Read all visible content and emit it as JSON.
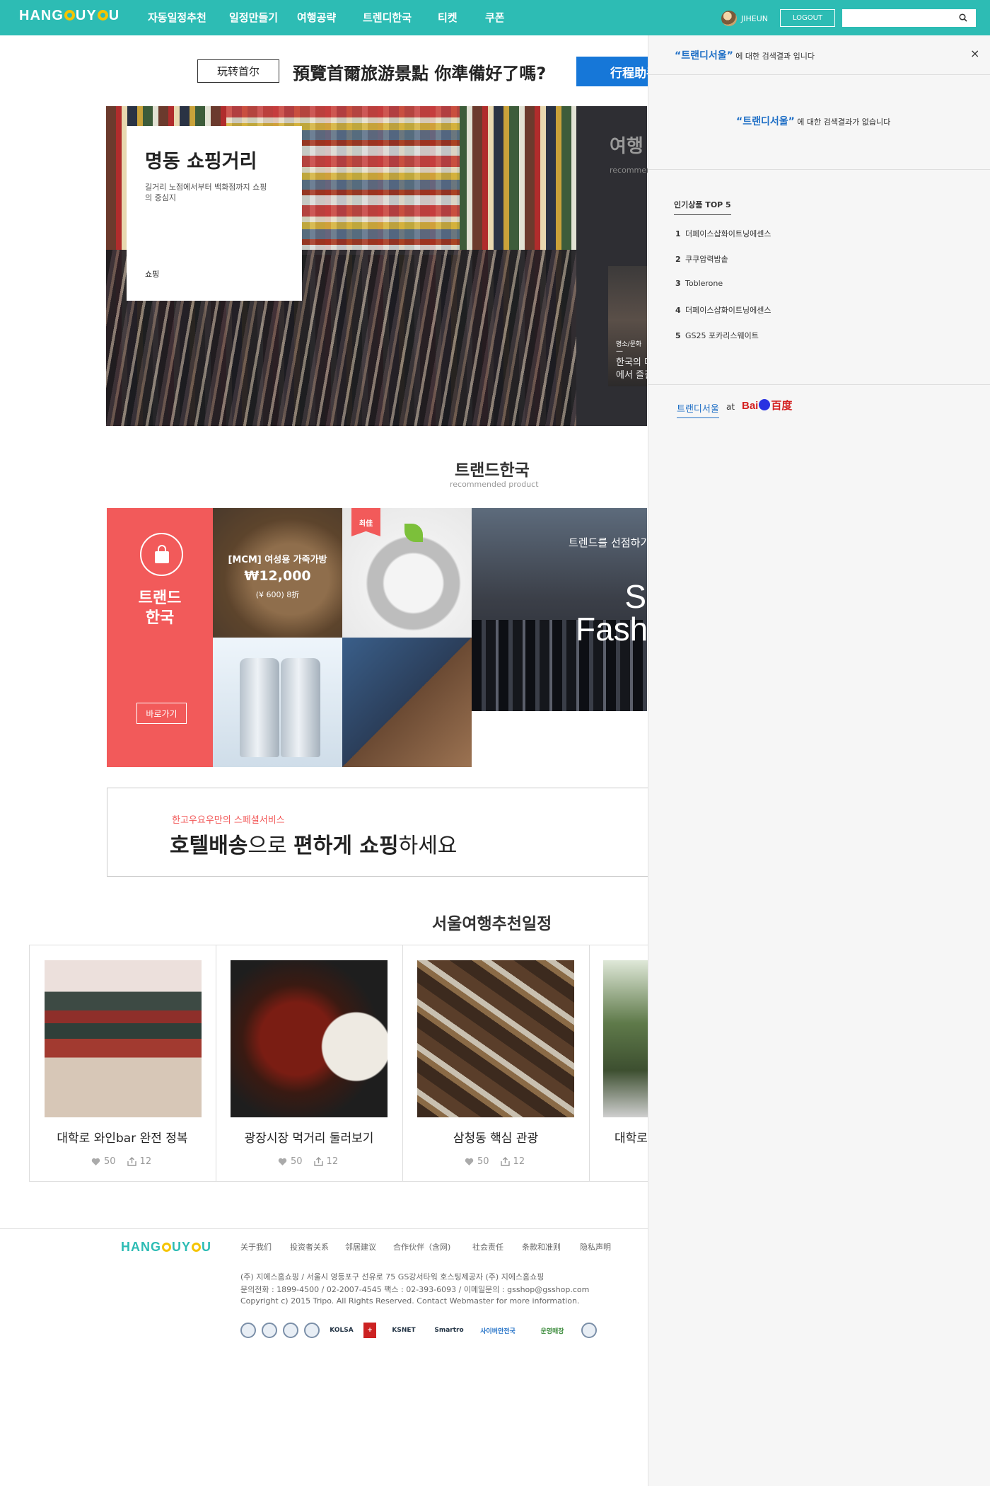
{
  "header": {
    "logo": {
      "pre": "HANG",
      "post": "UY",
      "last": "U"
    },
    "nav": [
      "자동일정추천",
      "일정만들기",
      "여행공략",
      "트렌디한국",
      "티켓",
      "쿠폰"
    ],
    "user": "JIHEUN",
    "logout": "LOGOUT",
    "search_value": "",
    "colors": {
      "bar": "#2dbcb4",
      "logo_o": "#f5c400"
    }
  },
  "promo": {
    "tag": "玩转首尔",
    "text": "預覽首爾旅游景點 你準備好了嗎?",
    "button": "行程助手"
  },
  "hero": {
    "title": "명동 쇼핑거리",
    "desc": "길거리 노점에서부터 백화점까지 쇼핑의 중심지",
    "category": "쇼핑",
    "side_title": "여행",
    "side_sub": "recommen",
    "side_card_cat": "명소/문화",
    "side_card_dash": "—",
    "side_card_text1": "한국의 다",
    "side_card_text2": "에서 즐길"
  },
  "trend": {
    "title": "트랜드한국",
    "subtitle": "recommended product",
    "panel_title_1": "트랜드",
    "panel_title_2": "한국",
    "goto": "바로가기",
    "bag_name": "[MCM] 여성용 가죽가방",
    "bag_price": "₩12,000",
    "bag_cny": "(¥ 600) 8折",
    "best_badge": "최佳",
    "fashion_line": "트렌드를 선점하기",
    "fashion_big_1": "S",
    "fashion_big_2": "Fashi"
  },
  "hotel": {
    "sub": "한고우요우만의 스페셜서비스",
    "main_b1": "호텔배송",
    "main_t1": "으로 ",
    "main_b2": "편하게 쇼핑",
    "main_t2": "하세요"
  },
  "itinerary": {
    "title": "서울여행추천일정",
    "cards": [
      {
        "title": "대학로 와인bar 완전 정복",
        "likes": "50",
        "shares": "12"
      },
      {
        "title": "광장시장 먹거리 둘러보기",
        "likes": "50",
        "shares": "12"
      },
      {
        "title": "삼청동 핵심 관광",
        "likes": "50",
        "shares": "12"
      },
      {
        "title": "대학로",
        "likes": "",
        "shares": ""
      }
    ]
  },
  "footer": {
    "links": [
      "关于我们",
      "投资者关系",
      "邻居建议",
      "合作伙伴（含网)",
      "社会责任",
      "条款和准则",
      "隐私声明"
    ],
    "addr1": "(주) 지에스홈쇼핑  / 서울시 영등포구 선유로 75 GS강서타워 호스팅제공자 (주) 지에스홈쇼핑",
    "addr2": "문의전화 : 1899-4500 / 02-2007-4545 팩스 : 02-393-6093 / 이메일문의 : gsshop@gsshop.com",
    "copyright": "Copyright c) 2015 Tripo. All Rights Reserved. Contact Webmaster for more information.",
    "badges": [
      "KOLSA",
      "KSNET",
      "Smartro",
      "사이버안전국",
      "운영매장"
    ]
  },
  "panel": {
    "query_kw": "“트랜디서울”",
    "query_tail": " 에 대한 검색결과 입니다",
    "noresult_kw": "“트랜디서울”",
    "noresult_tail": " 에 대한 검색결과가 없습니다",
    "top_title": "인기상품 TOP 5",
    "top": [
      {
        "rank": "1",
        "name": "더페이스샵화이트닝에센스"
      },
      {
        "rank": "2",
        "name": "쿠쿠압력밥솥"
      },
      {
        "rank": "3",
        "name": "Toblerone"
      },
      {
        "rank": "4",
        "name": "더페이스샵화이트닝에센스"
      },
      {
        "rank": "5",
        "name": "GS25 포카리스웨이트"
      }
    ],
    "keyword": "트랜디서울",
    "at": "at",
    "baidu_a": "Bai",
    "baidu_b": "百度",
    "close": "×"
  }
}
